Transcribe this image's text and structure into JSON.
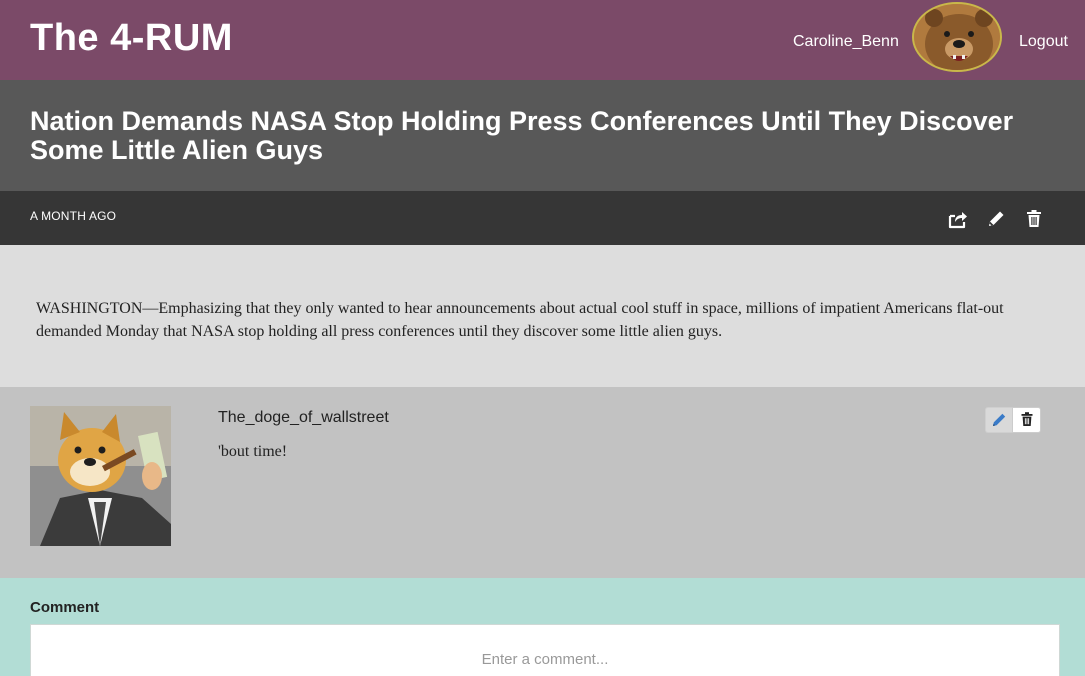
{
  "header": {
    "brand": "The 4-RUM",
    "username": "Caroline_Benn",
    "avatar_icon": "bear-avatar",
    "logout_label": "Logout"
  },
  "post": {
    "title": "Nation Demands NASA Stop Holding Press Conferences Until They Discover Some Little Alien Guys",
    "time_ago": "A MONTH AGO",
    "actions": [
      "share-icon",
      "edit-icon",
      "trash-icon"
    ],
    "body": "WASHINGTON—Emphasizing that they only wanted to hear announcements about actual cool stuff in space, millions of impatient Americans flat-out demanded Monday that NASA stop holding all press conferences until they discover some little alien guys."
  },
  "comments": [
    {
      "author": "The_doge_of_wallstreet",
      "text": "'bout time!",
      "avatar_icon": "doge-avatar",
      "actions": [
        "pencil-icon",
        "trash-icon"
      ]
    }
  ],
  "comment_form": {
    "label": "Comment",
    "placeholder": "Enter a comment..."
  },
  "colors": {
    "header": "#7b4a68",
    "title_bar": "#585858",
    "meta_bar": "#363636",
    "body_bg": "#dddddd",
    "comment_bg": "#c2c2c2",
    "form_bg": "#b2ddd5",
    "edit_accent": "#3a7bc8"
  }
}
